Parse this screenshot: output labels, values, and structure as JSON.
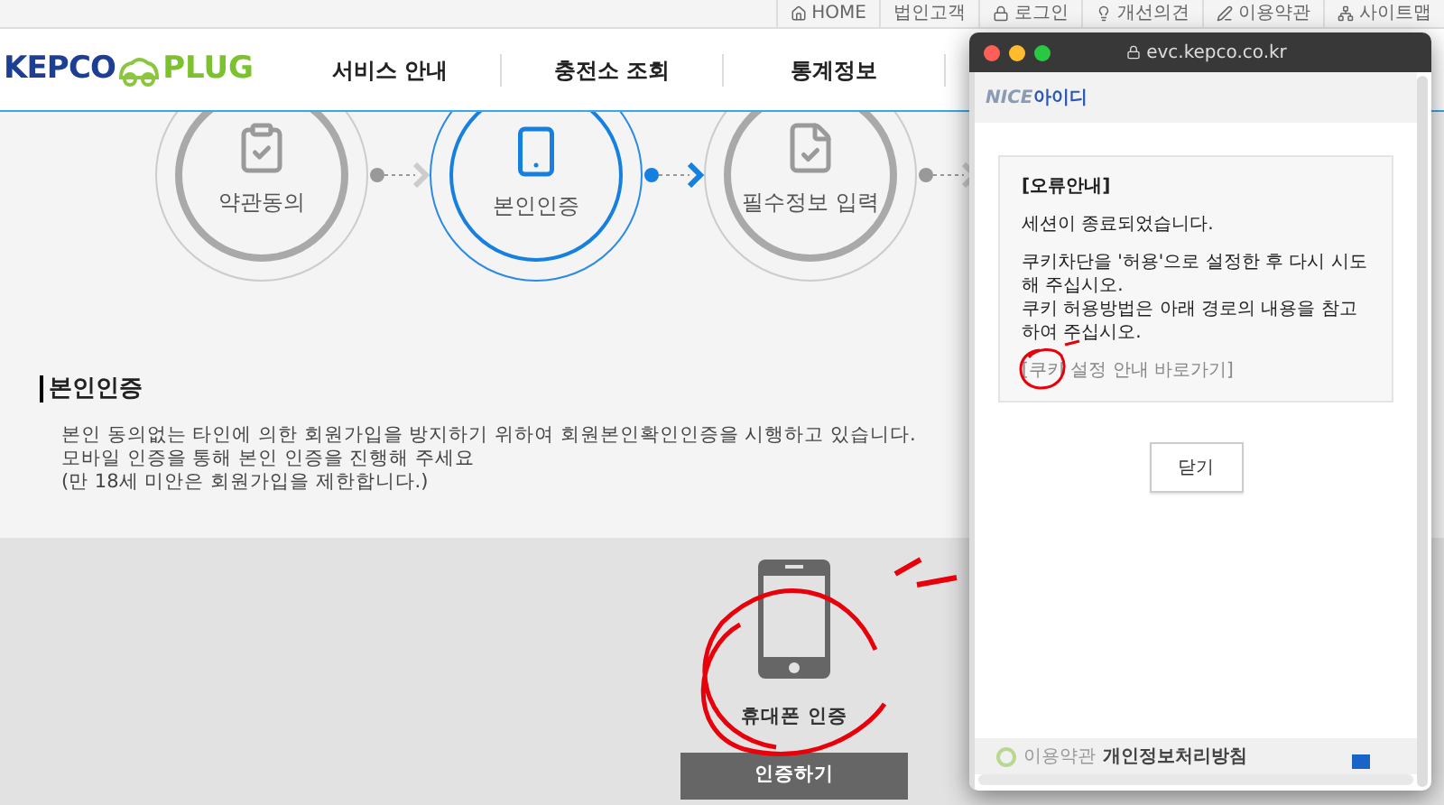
{
  "utility_links": [
    {
      "label": "HOME",
      "kind": "home"
    },
    {
      "label": "법인고객",
      "kind": "none"
    },
    {
      "label": "로그인",
      "kind": "lock"
    },
    {
      "label": "개선의견",
      "kind": "bulb"
    },
    {
      "label": "이용약관",
      "kind": "pen"
    },
    {
      "label": "사이트맵",
      "kind": "sitemap"
    }
  ],
  "logo": {
    "left": "KEPCO",
    "right": "PLUG"
  },
  "nav": [
    "서비스 안내",
    "충전소 조회",
    "통계정보"
  ],
  "steps": [
    {
      "label": "약관동의",
      "kind": "agree",
      "selected": false
    },
    {
      "label": "본인인증",
      "kind": "phone",
      "selected": true
    },
    {
      "label": "필수정보 입력",
      "kind": "form",
      "selected": false
    }
  ],
  "section": {
    "title": "본인인증",
    "lines": [
      "본인 동의없는 타인에 의한 회원가입을 방지하기 위하여 회원본인확인인증을 시행하고 있습니다.",
      "모바일 인증을 통해 본인 인증을 진행해 주세요",
      "(만 18세 미안은 회원가입을 제한합니다.)"
    ]
  },
  "verify": {
    "label": "휴대폰 인증",
    "button": "인증하기"
  },
  "popup": {
    "url": "evc.kepco.co.kr",
    "brand_left": "NICE",
    "brand_right": "아이디",
    "heading": "[오류안내]",
    "lines": [
      "세션이 종료되었습니다.",
      "쿠키차단을 '허용'으로 설정한 후 다시 시도해 주십시오.\n쿠키 허용방법은 아래 경로의 내용을 참고하여 주십시오."
    ],
    "link": "[쿠키 설정 안내 바로가기]",
    "button": "닫기",
    "footer": [
      "이용약관",
      "개인정보처리방침"
    ]
  }
}
